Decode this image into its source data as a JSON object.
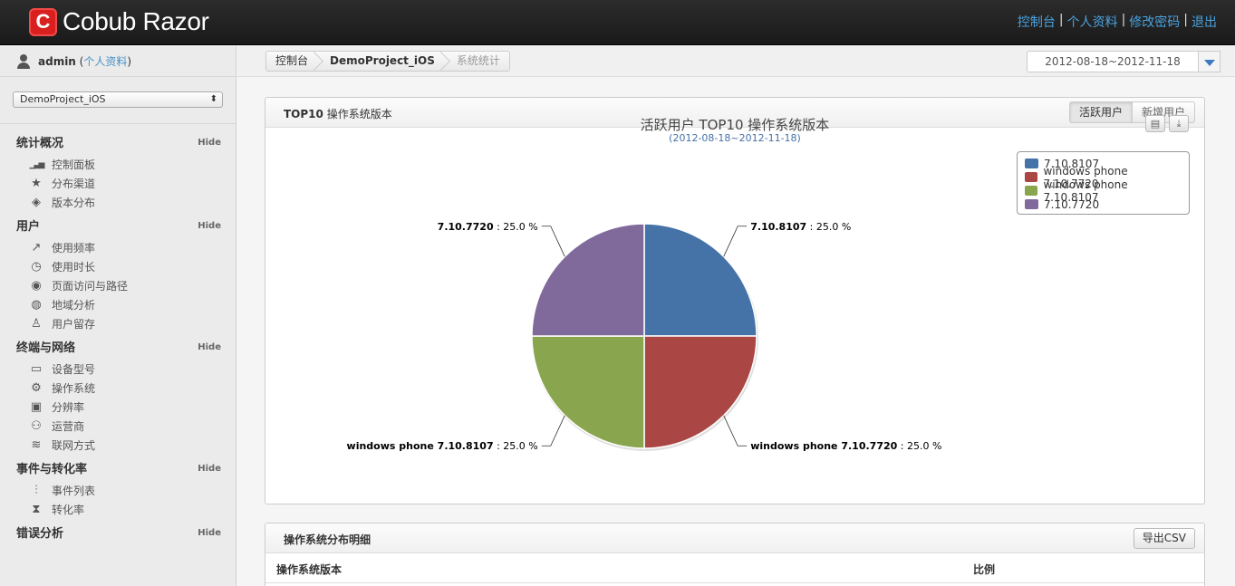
{
  "header": {
    "logo_letter": "C",
    "app_name": "Cobub Razor",
    "links": [
      "控制台",
      "个人资料",
      "修改密码",
      "退出"
    ]
  },
  "user": {
    "name": "admin",
    "profile_link": "个人资料"
  },
  "project": {
    "selected": "DemoProject_iOS"
  },
  "sidebar": {
    "hide_label": "Hide",
    "sections": [
      {
        "title": "统计概况",
        "items": [
          {
            "label": "控制面板",
            "icon": "bar-chart-icon"
          },
          {
            "label": "分布渠道",
            "icon": "star-icon"
          },
          {
            "label": "版本分布",
            "icon": "box-icon"
          }
        ]
      },
      {
        "title": "用户",
        "items": [
          {
            "label": "使用频率",
            "icon": "trend-icon"
          },
          {
            "label": "使用时长",
            "icon": "clock-icon"
          },
          {
            "label": "页面访问与路径",
            "icon": "magnifier-icon"
          },
          {
            "label": "地域分析",
            "icon": "globe-icon"
          },
          {
            "label": "用户留存",
            "icon": "user-add-icon"
          }
        ]
      },
      {
        "title": "终端与网络",
        "items": [
          {
            "label": "设备型号",
            "icon": "laptop-icon"
          },
          {
            "label": "操作系统",
            "icon": "gear-icon"
          },
          {
            "label": "分辨率",
            "icon": "tv-icon"
          },
          {
            "label": "运营商",
            "icon": "group-icon"
          },
          {
            "label": "联网方式",
            "icon": "wifi-icon"
          }
        ]
      },
      {
        "title": "事件与转化率",
        "items": [
          {
            "label": "事件列表",
            "icon": "sliders-icon"
          },
          {
            "label": "转化率",
            "icon": "hourglass-icon"
          }
        ]
      },
      {
        "title": "错误分析",
        "items": []
      }
    ]
  },
  "breadcrumb": {
    "home": "控制台",
    "project": "DemoProject_iOS",
    "current": "系统统计"
  },
  "date_range": "2012-08-18~2012-11-18",
  "chart_panel": {
    "title": "TOP10",
    "title_suffix": " 操作系统版本",
    "tab_active": "活跃用户",
    "tab_new": "新增用户",
    "print_icon": "print-icon",
    "download_icon": "download-icon"
  },
  "chart_data": {
    "type": "pie",
    "title": "活跃用户 TOP10 操作系统版本",
    "subtitle": "(2012-08-18~2012-11-18)",
    "legend_position": "top-right",
    "slices": [
      {
        "name": "7.10.8107",
        "value": 25.0,
        "color": "#4572a7",
        "label_suffix": " : 25.0 %"
      },
      {
        "name": "windows phone 7.10.7720",
        "value": 25.0,
        "color": "#aa4643",
        "label_suffix": " : 25.0 %"
      },
      {
        "name": "windows phone 7.10.8107",
        "value": 25.0,
        "color": "#89a54e",
        "label_suffix": " : 25.0 %"
      },
      {
        "name": "7.10.7720",
        "value": 25.0,
        "color": "#80699b",
        "label_suffix": " : 25.0 %"
      }
    ]
  },
  "detail_panel": {
    "title": "操作系统分布明细",
    "export_label": "导出CSV",
    "columns": [
      "操作系统版本",
      "比例"
    ]
  }
}
